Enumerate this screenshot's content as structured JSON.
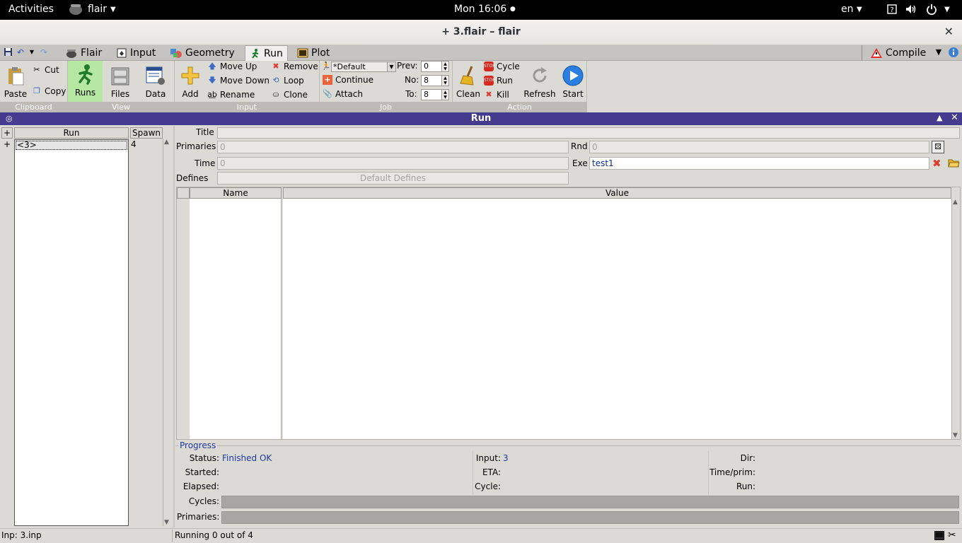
{
  "topbar": {
    "activities": "Activities",
    "app_name": "flair",
    "clock": "Mon 16:06",
    "language": "en"
  },
  "window": {
    "title": "+ 3.flair – flair",
    "close_glyph": "✕"
  },
  "tabs": [
    {
      "label": "Flair",
      "icon": "flair-pot-icon"
    },
    {
      "label": "Input",
      "icon": "input-icon"
    },
    {
      "label": "Geometry",
      "icon": "geometry-icon"
    },
    {
      "label": "Run",
      "icon": "run-icon",
      "active": true
    },
    {
      "label": "Plot",
      "icon": "plot-icon"
    }
  ],
  "compile": {
    "label": "Compile"
  },
  "ribbon": {
    "clipboard": {
      "group": "Clipboard",
      "paste": "Paste",
      "cut": "Cut",
      "copy": "Copy"
    },
    "view": {
      "group": "View",
      "runs": "Runs",
      "files": "Files",
      "data": "Data"
    },
    "input": {
      "group": "Input",
      "add": "Add",
      "move_up": "Move Up",
      "move_down": "Move Down",
      "rename": "Rename",
      "remove": "Remove",
      "loop": "Loop",
      "clone": "Clone"
    },
    "job": {
      "group": "Job",
      "queue_value": "*Default",
      "continue": "Continue",
      "attach": "Attach",
      "prev_label": "Prev:",
      "prev_value": "0",
      "no_label": "No:",
      "no_value": "8",
      "to_label": "To:",
      "to_value": "8"
    },
    "action": {
      "group": "Action",
      "clean": "Clean",
      "cycle": "Cycle",
      "run": "Run",
      "kill": "Kill",
      "refresh": "Refresh",
      "start": "Start"
    }
  },
  "panel": {
    "title": "Run"
  },
  "runs_list": {
    "col_plus": "+",
    "col_run": "Run",
    "col_spawn": "Spawn",
    "rows": [
      {
        "expander": "+",
        "run": "<3>",
        "spawn": "4"
      }
    ]
  },
  "form": {
    "title_label": "Title",
    "title_value": "",
    "primaries_label": "Primaries",
    "primaries_value": "0",
    "rnd_label": "Rnd",
    "rnd_value": "0",
    "time_label": "Time",
    "time_value": "0",
    "exe_label": "Exe",
    "exe_value": "test1",
    "defines_label": "Defines",
    "defines_button": "Default Defines"
  },
  "defines_table": {
    "col_name": "Name",
    "col_value": "Value"
  },
  "progress": {
    "group": "Progress",
    "status_label": "Status:",
    "status_value": "Finished OK",
    "input_label": "Input:",
    "input_value": "3",
    "dir_label": "Dir:",
    "started_label": "Started:",
    "eta_label": "ETA:",
    "timeprim_label": "Time/prim:",
    "elapsed_label": "Elapsed:",
    "cycle_label": "Cycle:",
    "run_label": "Run:",
    "cycles_label": "Cycles:",
    "primaries_label": "Primaries:"
  },
  "statusbar": {
    "left": "Inp: 3.inp",
    "right": "Running 0 out of 4"
  },
  "colors": {
    "panel_header": "#433b8e",
    "selected_view": "#b7e8a2",
    "value_blue": "#1e3aa8"
  }
}
